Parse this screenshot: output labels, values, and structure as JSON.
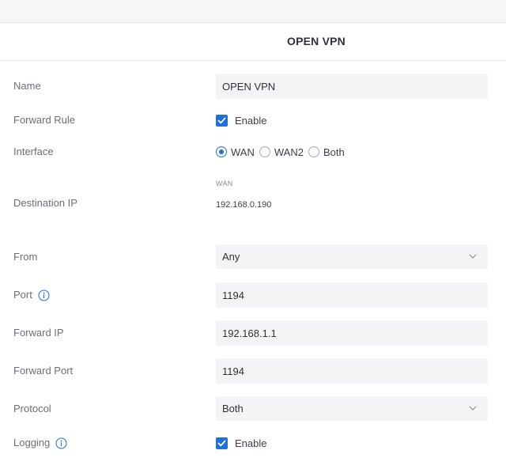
{
  "header": {
    "title": "OPEN VPN"
  },
  "form": {
    "name": {
      "label": "Name",
      "value": "OPEN VPN"
    },
    "forward_rule": {
      "label": "Forward Rule",
      "checkbox_label": "Enable",
      "checked": true
    },
    "interface": {
      "label": "Interface",
      "options": [
        "WAN",
        "WAN2",
        "Both"
      ],
      "selected": "WAN"
    },
    "destination_ip": {
      "label": "Destination IP",
      "caption": "WAN",
      "value": "192.168.0.190"
    },
    "from": {
      "label": "From",
      "value": "Any"
    },
    "port": {
      "label": "Port",
      "value": "1194"
    },
    "forward_ip": {
      "label": "Forward IP",
      "value": "192.168.1.1"
    },
    "forward_port": {
      "label": "Forward Port",
      "value": "1194"
    },
    "protocol": {
      "label": "Protocol",
      "value": "Both"
    },
    "logging": {
      "label": "Logging",
      "checkbox_label": "Enable",
      "checked": true
    }
  },
  "colors": {
    "accent": "#1f6fe0",
    "field_bg": "#f4f4f7",
    "label_text": "#6b6e76"
  },
  "icons": {
    "info": "info-icon",
    "check": "check-icon",
    "chevron": "chevron-down-icon"
  }
}
